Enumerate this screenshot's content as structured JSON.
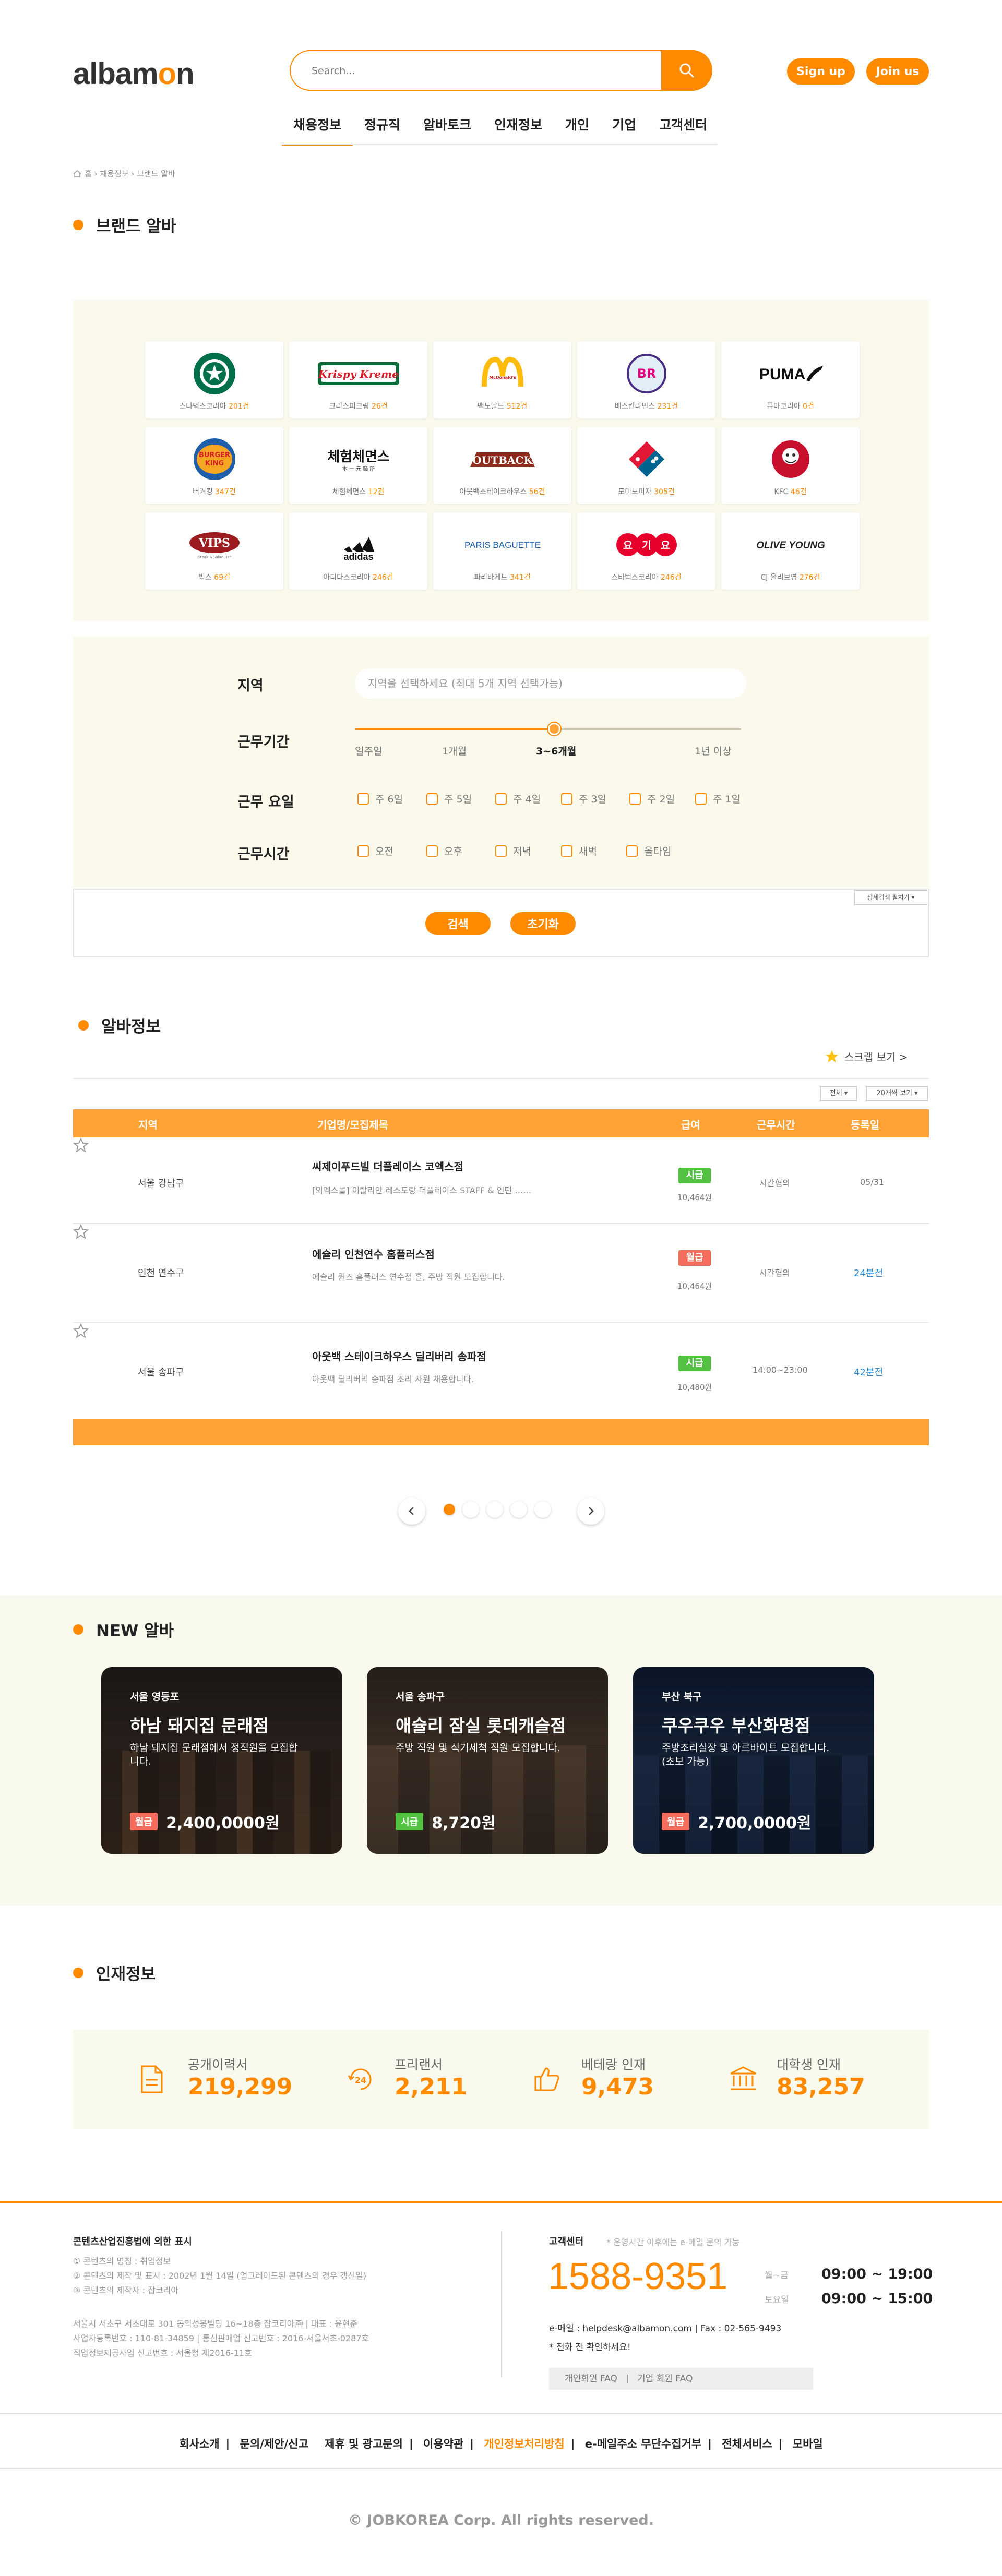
{
  "header": {
    "logo": "albamon",
    "search_placeholder": "Search...",
    "signup": "Sign up",
    "join": "Join us"
  },
  "nav": [
    "채용정보",
    "정규직",
    "알바토크",
    "인재정보",
    "개인",
    "기업",
    "고객센터"
  ],
  "breadcrumb": "홈 › 채용정보 › 브랜드 알바",
  "brand_section": {
    "title": "브랜드 알바",
    "brands": [
      {
        "name": "스타벅스코리아",
        "count": "201건"
      },
      {
        "name": "크리스피크림",
        "count": "26건"
      },
      {
        "name": "맥도날드",
        "count": "512건"
      },
      {
        "name": "베스킨라빈스",
        "count": "231건"
      },
      {
        "name": "퓨마코리아",
        "count": "0건"
      },
      {
        "name": "버거킹",
        "count": "347건"
      },
      {
        "name": "체험체면스",
        "count": "12건"
      },
      {
        "name": "아웃백스테이크하우스",
        "count": "56건"
      },
      {
        "name": "도미노피자",
        "count": "305건"
      },
      {
        "name": "KFC",
        "count": "46건"
      },
      {
        "name": "빕스",
        "count": "69건"
      },
      {
        "name": "아디다스코리아",
        "count": "246건"
      },
      {
        "name": "파리바게트",
        "count": "341건"
      },
      {
        "name": "스타벅스코리아",
        "count": "246건"
      },
      {
        "name": "CJ 올리브영",
        "count": "276건"
      }
    ],
    "logo_text": [
      "STARBUCKS",
      "Krispy Kreme",
      "McDonald's",
      "BR",
      "PUMA",
      "BURGER KING",
      "체험체면스",
      "OUTBACK",
      "Domino's",
      "KFC",
      "VIPS",
      "adidas",
      "PARIS BAGUETTE",
      "요기요",
      "OLIVE YOUNG"
    ]
  },
  "filter": {
    "region_label": "지역",
    "region_placeholder": "지역을 선택하세요 (최대 5개 지역 선택가능)",
    "period_label": "근무기간",
    "period_ticks": [
      "일주일",
      "1개월",
      "3~6개월",
      "1년 이상"
    ],
    "day_label": "근무 요일",
    "days": [
      "주 6일",
      "주 5일",
      "주 4일",
      "주 3일",
      "주 2일",
      "주 1일"
    ],
    "time_label": "근무시간",
    "times": [
      "오전",
      "오후",
      "저녁",
      "새벽",
      "올타임"
    ],
    "detail_button": "상세검색 펼치기 ▾",
    "search_button": "검색",
    "reset_button": "초기화"
  },
  "jobs_section": {
    "title": "알바정보",
    "scrap": "스크랩 보기 >",
    "sort1": "전체 ▾",
    "sort2": "20개씩 보기 ▾",
    "headers": [
      "지역",
      "기업명/모집제목",
      "급여",
      "근무시간",
      "등록일"
    ],
    "rows": [
      {
        "region": "서울 강남구",
        "company": "씨제이푸드빌 더플레이스 코엑스점",
        "desc": "[외엑스몰] 이탈리안 레스토랑 더플레이스 STAFF & 인턴 ……",
        "pay_type": "시급",
        "pay": "10,464원",
        "hours": "시간협의",
        "date": "05/31"
      },
      {
        "region": "인천 연수구",
        "company": "에슐리 인천연수 홈플러스점",
        "desc": "에슐리 퀸즈 홈플러스 연수점 홀, 주방 직원 모집합니다.",
        "pay_type": "월급",
        "pay": "10,464원",
        "hours": "시간협의",
        "date": "24분전"
      },
      {
        "region": "서울 송파구",
        "company": "아웃백 스테이크하우스 딜리버리 송파점",
        "desc": "아웃백 딜리버리 송파점 조리 사원 채용합니다.",
        "pay_type": "시급",
        "pay": "10,480원",
        "hours": "14:00~23:00",
        "date": "42분전"
      }
    ]
  },
  "new_section": {
    "title": "NEW 알바",
    "cards": [
      {
        "region": "서울 영등포",
        "title": "하남 돼지집 문래점",
        "desc": "하남 돼지집 문래점에서 정직원을 모집합니다.",
        "pay_type": "월급",
        "pay": "2,400,0000원"
      },
      {
        "region": "서울 송파구",
        "title": "애슐리 잠실 롯데캐슬점",
        "desc": "주방 직원 및 식기세척 직원 모집합니다.",
        "pay_type": "시급",
        "pay": "8,720원"
      },
      {
        "region": "부산 북구",
        "title": "쿠우쿠우 부산화명점",
        "desc": "주방조리실장 및 아르바이트 모집합니다. (초보 가능)",
        "pay_type": "월급",
        "pay": "2,700,0000원"
      }
    ]
  },
  "talent_section": {
    "title": "인재정보",
    "stats": [
      {
        "label": "공개이력서",
        "value": "219,299"
      },
      {
        "label": "프리랜서",
        "value": "2,211"
      },
      {
        "label": "베테랑 인재",
        "value": "9,473"
      },
      {
        "label": "대학생 인재",
        "value": "83,257"
      }
    ]
  },
  "footer": {
    "notice_title": "콘텐츠산업진흥법에 의한 표시",
    "notice_lines": [
      "① 콘텐츠의 명칭 : 취업정보",
      "② 콘텐츠의 제작 및 표시 : 2002년 1월 14일 (업그레이드된 콘텐츠의 경우 갱신일)",
      "③ 콘텐츠의 제작자 : 잡코리아"
    ],
    "company_lines": [
      "서울시 서초구 서초대로 301 동익성봉빌딩 16~18층 잡코리아㈜ | 대표 : 윤현준",
      "사업자등록번호 : 110-81-34859 | 통신판매업 신고번호 : 2016-서울서초-0287호",
      "직업정보제공사업 신고번호 : 서울청 제2016-11호"
    ],
    "cs_title": "고객센터",
    "cs_note": "* 운영시간 이후에는 e-메일 문의 가능",
    "phone": "1588-9351",
    "weekday_label": "월~금",
    "weekday_time": "09:00 ~ 19:00",
    "sat_label": "토요일",
    "sat_time": "09:00 ~ 15:00",
    "email": "e-메일 : helpdesk@albamon.com | Fax : 02-565-9493",
    "call_note": "* 전화 전 확인하세요!",
    "faq": "개인회원 FAQ   |   기업 회원 FAQ",
    "links": [
      "회사소개",
      "문의/제안/신고",
      "제휴 및 광고문의",
      "이용약관",
      "개인정보처리방침",
      "e-메일주소 무단수집거부",
      "전체서비스",
      "모바일"
    ],
    "copyright": "© JOBKOREA Corp. All rights reserved."
  }
}
